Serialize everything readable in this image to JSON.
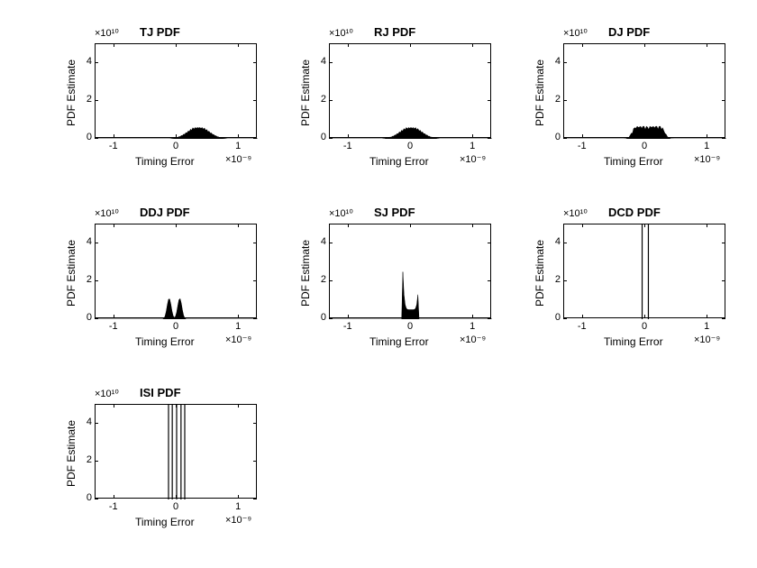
{
  "chart_data": [
    {
      "id": "tj",
      "type": "area",
      "title": "TJ PDF",
      "xlabel": "Timing Error",
      "ylabel": "PDF Estimate",
      "xmult": "×10⁻⁹",
      "ymult": "×10¹⁰",
      "xlim": [
        -1.3,
        1.3
      ],
      "ylim": [
        0,
        5
      ],
      "xticks": [
        -1,
        0,
        1
      ],
      "yticks": [
        0,
        2,
        4
      ],
      "shape": "gaussian",
      "center": 0.35,
      "width": 0.5,
      "height": 0.6
    },
    {
      "id": "rj",
      "type": "area",
      "title": "RJ PDF",
      "xlabel": "Timing Error",
      "ylabel": "PDF Estimate",
      "xmult": "×10⁻⁹",
      "ymult": "×10¹⁰",
      "xlim": [
        -1.3,
        1.3
      ],
      "ylim": [
        0,
        5
      ],
      "xticks": [
        -1,
        0,
        1
      ],
      "yticks": [
        0,
        2,
        4
      ],
      "shape": "gaussian",
      "center": 0.0,
      "width": 0.5,
      "height": 0.6
    },
    {
      "id": "dj",
      "type": "area",
      "title": "DJ PDF",
      "xlabel": "Timing Error",
      "ylabel": "PDF Estimate",
      "xmult": "×10⁻⁹",
      "ymult": "×10¹⁰",
      "xlim": [
        -1.3,
        1.3
      ],
      "ylim": [
        0,
        5
      ],
      "xticks": [
        -1,
        0,
        1
      ],
      "yticks": [
        0,
        2,
        4
      ],
      "shape": "multimodal",
      "center": 0.0,
      "width": 0.5,
      "height": 0.6
    },
    {
      "id": "ddj",
      "type": "area",
      "title": "DDJ PDF",
      "xlabel": "Timing Error",
      "ylabel": "PDF Estimate",
      "xmult": "×10⁻⁹",
      "ymult": "×10¹⁰",
      "xlim": [
        -1.3,
        1.3
      ],
      "ylim": [
        0,
        5
      ],
      "xticks": [
        -1,
        0,
        1
      ],
      "yticks": [
        0,
        2,
        4
      ],
      "shape": "twopeaks",
      "peaks": [
        -0.12,
        0.05
      ],
      "peakwidth": 0.1,
      "height": 1.1
    },
    {
      "id": "sj",
      "type": "area",
      "title": "SJ PDF",
      "xlabel": "Timing Error",
      "ylabel": "PDF Estimate",
      "xmult": "×10⁻⁹",
      "ymult": "×10¹⁰",
      "xlim": [
        -1.3,
        1.3
      ],
      "ylim": [
        0,
        5
      ],
      "xticks": [
        -1,
        0,
        1
      ],
      "yticks": [
        0,
        2,
        4
      ],
      "shape": "bathtub",
      "center": 0.0,
      "halfwidth": 0.13,
      "height": 2.5,
      "floor": 0.5
    },
    {
      "id": "dcd",
      "type": "line",
      "title": "DCD PDF",
      "xlabel": "Timing Error",
      "ylabel": "PDF Estimate",
      "xmult": "×10⁻⁹",
      "ymult": "×10¹⁰",
      "xlim": [
        -1.3,
        1.3
      ],
      "ylim": [
        0,
        5
      ],
      "xticks": [
        -1,
        0,
        1
      ],
      "yticks": [
        0,
        2,
        4
      ],
      "shape": "impulses",
      "positions": [
        -0.05,
        0.05
      ],
      "height": 5
    },
    {
      "id": "isi",
      "type": "line",
      "title": "ISI PDF",
      "xlabel": "Timing Error",
      "ylabel": "PDF Estimate",
      "xmult": "×10⁻⁹",
      "ymult": "×10¹⁰",
      "xlim": [
        -1.3,
        1.3
      ],
      "ylim": [
        0,
        5
      ],
      "xticks": [
        -1,
        0,
        1
      ],
      "yticks": [
        0,
        2,
        4
      ],
      "shape": "impulses",
      "positions": [
        -0.13,
        -0.07,
        0.0,
        0.07,
        0.13
      ],
      "height": 5
    }
  ]
}
